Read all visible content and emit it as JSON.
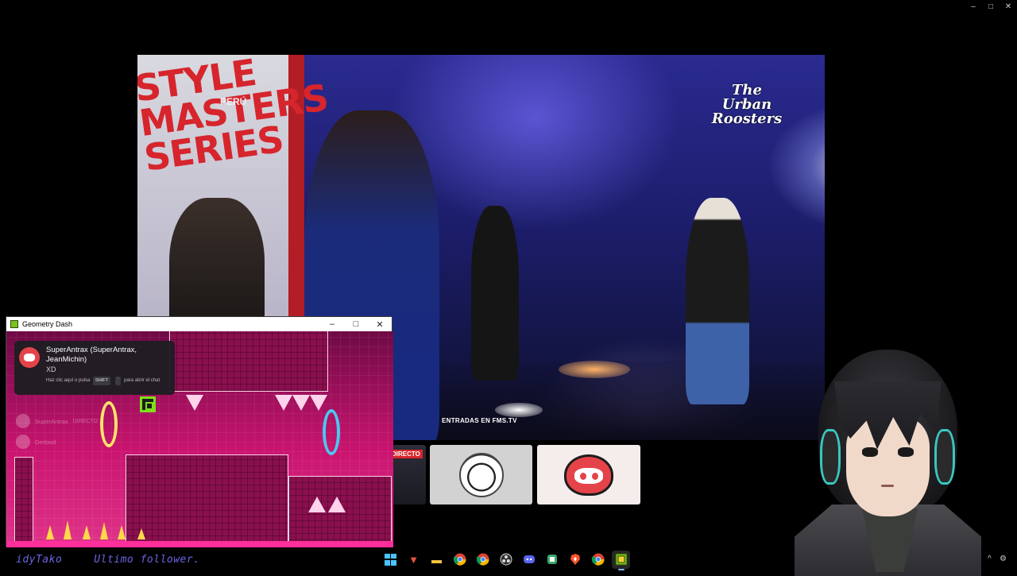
{
  "window": {
    "controls": {
      "minimize": "–",
      "maximize": "□",
      "close": "✕"
    }
  },
  "stream": {
    "banner_text": "STYLE MASTERS SERIES",
    "banner_country": "PERÚ",
    "brand_logo": "The Urban Roosters",
    "ticket_text": "ENTRADAS EN FMS.TV"
  },
  "thumbnails": {
    "live_label": "DIRECTO",
    "items": [
      "live-stream-thumbnail",
      "anime-avatar-thumbnail",
      "discord-bot-thumbnail"
    ]
  },
  "geometry_dash": {
    "title": "Geometry Dash",
    "controls": {
      "minimize": "–",
      "maximize": "□",
      "close": "✕"
    }
  },
  "notification": {
    "app": "discord",
    "sender": "SuperAntrax (SuperAntrax, JeanMichin)",
    "message": "XD",
    "hint_prefix": "Haz clic aquí o pulsa",
    "key1": "SHIFT",
    "key2": "`",
    "hint_suffix": "para abrir el chat"
  },
  "chat_overlay": {
    "items": [
      {
        "name": "SuperAntrax",
        "tag": "DIRECTO"
      },
      {
        "name": "Derlood",
        "tag": ""
      }
    ]
  },
  "ticker": {
    "left": "idyTako",
    "right": "Ultimo follower."
  },
  "taskbar": {
    "icons": [
      "start-icon",
      "app-icon",
      "file-explorer-icon",
      "chrome-icon",
      "chrome-alt-icon",
      "obs-icon",
      "discord-icon",
      "app-icon",
      "brave-icon",
      "chrome-icon",
      "geometry-dash-icon"
    ],
    "accent": "#4cc2ff"
  },
  "colors": {
    "discord_red": "#e5434a",
    "gd_pink": "#c9146f",
    "gd_player_green": "#7fe01a",
    "vtuber_headphone": "#38c7c0",
    "ticker_purple": "#6c64e0"
  }
}
